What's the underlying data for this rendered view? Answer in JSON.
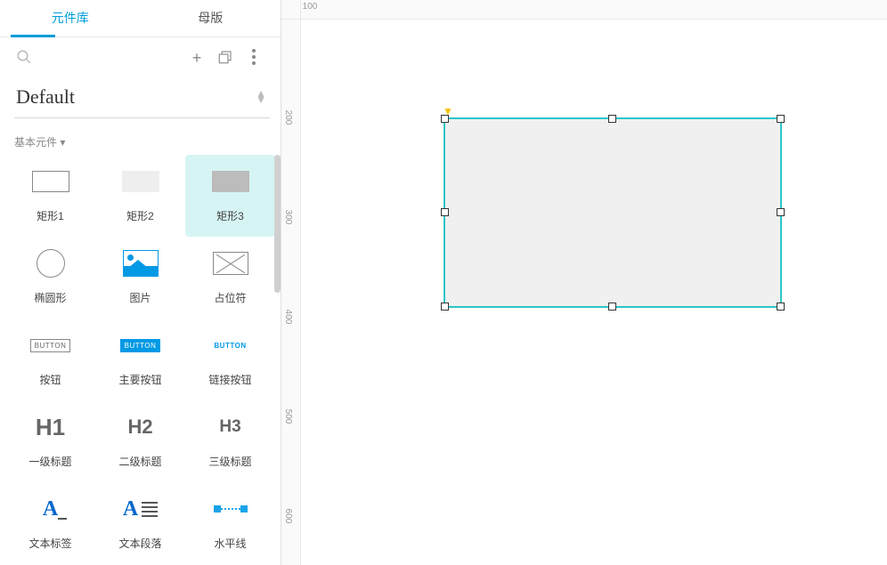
{
  "tabs": {
    "library": "元件库",
    "master": "母版"
  },
  "library_select": {
    "name": "Default"
  },
  "section": {
    "basic": "基本元件 ▾"
  },
  "button_text": "BUTTON",
  "headings": {
    "h1": "H1",
    "h2": "H2",
    "h3": "H3"
  },
  "glyph_A": "A",
  "widgets": {
    "rect1": "矩形1",
    "rect2": "矩形2",
    "rect3": "矩形3",
    "ellipse": "椭圆形",
    "image": "图片",
    "placeholder": "占位符",
    "button": "按钮",
    "primary_button": "主要按钮",
    "link_button": "链接按钮",
    "h1": "一级标题",
    "h2": "二级标题",
    "h3": "三级标题",
    "text_label": "文本标签",
    "paragraph": "文本段落",
    "hr": "水平线"
  },
  "ruler": {
    "h": [
      "100"
    ],
    "v": [
      "200",
      "300",
      "400",
      "500",
      "600"
    ]
  },
  "colors": {
    "accent": "#009dd9",
    "selection": "#2cc6c6",
    "cell_highlight": "#d6f4f4"
  }
}
